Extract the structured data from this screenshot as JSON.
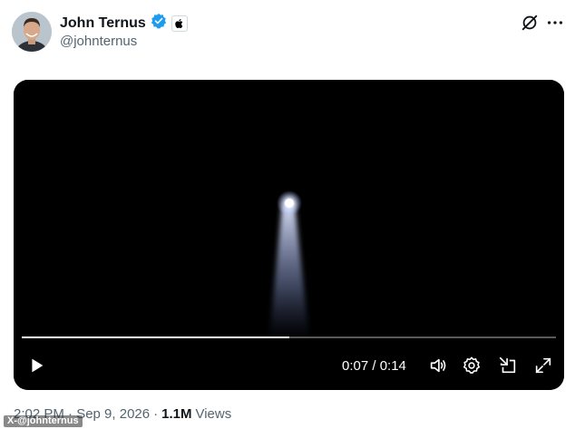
{
  "author": {
    "display_name": "John Ternus",
    "handle": "@johnternus",
    "verified": true,
    "affiliate_badge": "apple-logo-icon",
    "avatar": "avatar-photo"
  },
  "header_actions": [
    "grok-icon",
    "more-icon"
  ],
  "video": {
    "elapsed": "0:07",
    "duration": "0:14",
    "time_display": "0:07 / 0:14",
    "progress_fraction": 0.5,
    "controls": [
      "play-icon",
      "volume-icon",
      "settings-icon",
      "picture-in-picture-icon",
      "fullscreen-icon"
    ]
  },
  "meta": {
    "timestamp": "2:02 PM · Sep 9, 2026",
    "separator": "·",
    "views_count": "1.1M",
    "views_label": "Views"
  },
  "watermark": "X-@johnternus",
  "colors": {
    "text_primary": "#0f1419",
    "text_secondary": "#536471",
    "verified_blue": "#1d9bf0",
    "video_bg": "#000000"
  }
}
